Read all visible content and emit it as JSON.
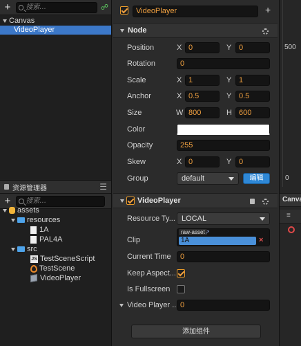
{
  "hierarchy": {
    "search_placeholder": "搜索...",
    "nodes": [
      {
        "label": "Canvas",
        "expanded": true
      },
      {
        "label": "VideoPlayer",
        "selected": true
      }
    ]
  },
  "assets": {
    "title": "资源管理器",
    "search_placeholder": "搜索...",
    "items": [
      {
        "label": "assets",
        "icon": "db-icon"
      },
      {
        "label": "resources",
        "icon": "folder-icon"
      },
      {
        "label": "1A",
        "icon": "file-icon"
      },
      {
        "label": "PAL4A",
        "icon": "file-icon"
      },
      {
        "label": "src",
        "icon": "folder-icon"
      },
      {
        "label": "TestSceneScript",
        "icon": "js-icon"
      },
      {
        "label": "TestScene",
        "icon": "scene-icon"
      },
      {
        "label": "VideoPlayer",
        "icon": "prefab-icon"
      }
    ]
  },
  "inspector": {
    "node_name": "VideoPlayer",
    "node_active": true,
    "node_section": "Node",
    "position": {
      "label": "Position",
      "x": "0",
      "y": "0"
    },
    "rotation": {
      "label": "Rotation",
      "value": "0"
    },
    "scale": {
      "label": "Scale",
      "x": "1",
      "y": "1"
    },
    "anchor": {
      "label": "Anchor",
      "x": "0.5",
      "y": "0.5"
    },
    "size": {
      "label": "Size",
      "w": "800",
      "h": "600"
    },
    "color": {
      "label": "Color",
      "value": "#ffffff"
    },
    "opacity": {
      "label": "Opacity",
      "value": "255"
    },
    "skew": {
      "label": "Skew",
      "x": "0",
      "y": "0"
    },
    "group": {
      "label": "Group",
      "value": "default",
      "edit": "编辑"
    },
    "axis_labels": {
      "x": "X",
      "y": "Y",
      "w": "W",
      "h": "H"
    },
    "component": {
      "title": "VideoPlayer",
      "enabled": true,
      "resource_type": {
        "label": "Resource Ty...",
        "value": "LOCAL"
      },
      "clip": {
        "label": "Clip",
        "tag": "raw-asset",
        "value": "1A"
      },
      "current_time": {
        "label": "Current Time",
        "value": "0"
      },
      "keep_aspect": {
        "label": "Keep Aspect...",
        "checked": true
      },
      "is_fullscreen": {
        "label": "Is Fullscreen",
        "checked": false
      },
      "video_player_event": {
        "label": "Video Player ...",
        "value": "0"
      }
    },
    "add_component": "添加组件"
  },
  "right_panel": {
    "value_500": "500",
    "value_0": "0",
    "tab_label": "Canva"
  }
}
